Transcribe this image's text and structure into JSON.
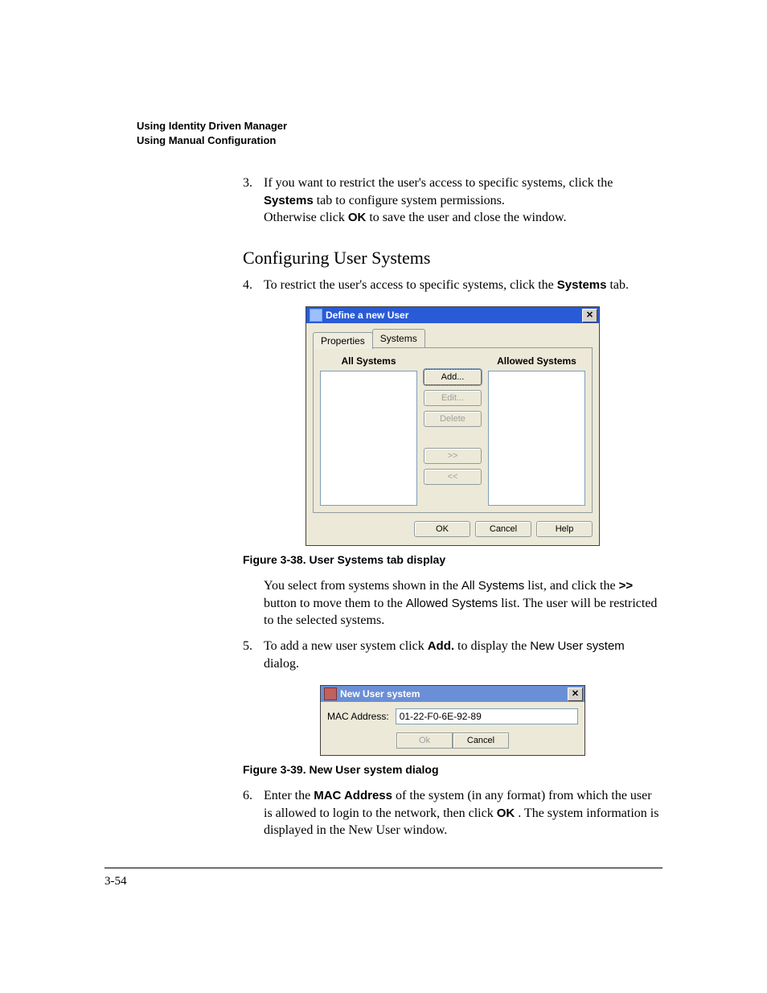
{
  "running_head": {
    "line1": "Using Identity Driven Manager",
    "line2": "Using Manual Configuration"
  },
  "step3": {
    "num": "3.",
    "a": "If you want to restrict the user's access to specific systems, click the ",
    "systems": "Systems",
    "b": " tab to configure system permissions.",
    "c": "Otherwise click ",
    "ok": "OK",
    "d": " to save the user and close the window."
  },
  "heading": "Configuring User Systems",
  "step4": {
    "num": "4.",
    "a": "To restrict the user's access to specific systems, click the ",
    "systems": "Systems",
    "b": " tab."
  },
  "dialog1": {
    "title": "Define a new User",
    "tab_properties": "Properties",
    "tab_systems": "Systems",
    "all_systems": "All Systems",
    "allowed_systems": "Allowed Systems",
    "btn_add": "Add...",
    "btn_edit": "Edit...",
    "btn_delete": "Delete",
    "btn_right": ">>",
    "btn_left": "<<",
    "btn_ok": "OK",
    "btn_cancel": "Cancel",
    "btn_help": "Help"
  },
  "caption1": "Figure 3-38. User Systems tab display",
  "para1": {
    "a": "You select from systems shown in the ",
    "b": "All Systems",
    "c": " list, and click the ",
    "d": ">>",
    "e": " button to move them to the ",
    "f": "Allowed Systems",
    "g": " list. The user will be restricted to the selected systems."
  },
  "step5": {
    "num": "5.",
    "a": "To add a new user system click ",
    "add": "Add.",
    "b": " to display the ",
    "nus": "New User system",
    "c": " dialog."
  },
  "dialog2": {
    "title": "New User system",
    "label": "MAC Address:",
    "value": "01-22-F0-6E-92-89",
    "btn_ok": "Ok",
    "btn_cancel": "Cancel"
  },
  "caption2": "Figure 3-39. New User system dialog",
  "step6": {
    "num": "6.",
    "a": "Enter the ",
    "mac": "MAC Address",
    "b": " of the system (in any format) from which the user is allowed to login to the network, then click ",
    "ok": "OK",
    "c": ". The system information is displayed in the New User window."
  },
  "page_number": "3-54"
}
